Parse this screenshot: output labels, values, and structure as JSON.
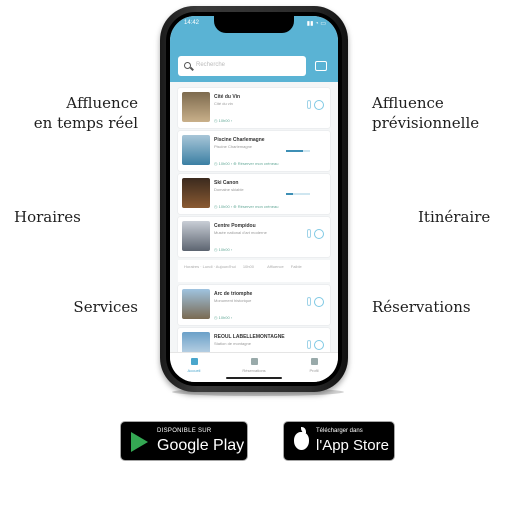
{
  "features": {
    "left": [
      "Affluence",
      "en temps réel",
      "Horaires",
      "Services"
    ],
    "right": [
      "Affluence",
      "prévisionnelle",
      "Itinéraire",
      "Réservations"
    ]
  },
  "app": {
    "status_time": "14:42",
    "status_icons": "▮▮ ◔ ▭",
    "search_placeholder": "Recherche",
    "accent_color": "#5ab3d4",
    "cards": [
      {
        "title": "Cité du Vin",
        "subtitle": "Cité du vin",
        "meta": "◷ 10h00 ›"
      },
      {
        "title": "Piscine Charlemagne",
        "subtitle": "Piscine Charlemagne",
        "meta": "◷ 10h00 ›  ⊕ Réserver mon créneau"
      },
      {
        "title": "Ski Canon",
        "subtitle": "Domaine skiable",
        "meta": "◷ 10h00 ›  ⊕ Réserver mon créneau"
      },
      {
        "title": "Centre Pompidou",
        "subtitle": "Musée national d'art moderne",
        "meta": "◷ 10h00 ›"
      },
      {
        "title": "Arc de triomphe",
        "subtitle": "Monument historique",
        "meta": "◷ 10h00 ›"
      },
      {
        "title": "REOUL LABELLEMONTAGNE",
        "subtitle": "Station de montagne",
        "meta": ""
      }
    ],
    "details": [
      "Horaires · Lundi · Aujourd'hui",
      "10h00",
      "Affluence",
      "Faible"
    ],
    "tabs": [
      "Accueil",
      "Réservations",
      "Profil"
    ]
  },
  "stores": {
    "google_small": "DISPONIBLE SUR",
    "google_big": "Google Play",
    "apple_small": "Télécharger dans",
    "apple_big": "l'App Store"
  }
}
